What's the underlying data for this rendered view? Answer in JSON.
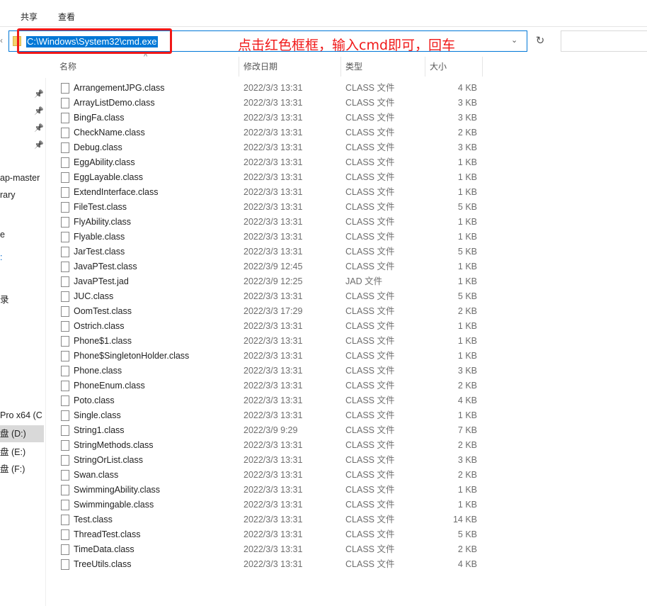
{
  "ribbon": {
    "tabs": [
      "共享",
      "查看"
    ]
  },
  "address": {
    "path": "C:\\Windows\\System32\\cmd.exe"
  },
  "annotation": "点击红色框框，输入cmd即可，回车",
  "columns": {
    "name": "名称",
    "date": "修改日期",
    "type": "类型",
    "size": "大小"
  },
  "sidebar": {
    "items": [
      "ap-master",
      "rary",
      "e",
      ":",
      "录",
      "Pro x64 (C",
      "盘 (D:)",
      "盘 (E:)",
      "盘 (F:)"
    ],
    "selected": "盘 (D:)"
  },
  "files": [
    [
      "ArrangementJPG.class",
      "2022/3/3 13:31",
      "CLASS 文件",
      "4 KB"
    ],
    [
      "ArrayListDemo.class",
      "2022/3/3 13:31",
      "CLASS 文件",
      "3 KB"
    ],
    [
      "BingFa.class",
      "2022/3/3 13:31",
      "CLASS 文件",
      "3 KB"
    ],
    [
      "CheckName.class",
      "2022/3/3 13:31",
      "CLASS 文件",
      "2 KB"
    ],
    [
      "Debug.class",
      "2022/3/3 13:31",
      "CLASS 文件",
      "3 KB"
    ],
    [
      "EggAbility.class",
      "2022/3/3 13:31",
      "CLASS 文件",
      "1 KB"
    ],
    [
      "EggLayable.class",
      "2022/3/3 13:31",
      "CLASS 文件",
      "1 KB"
    ],
    [
      "ExtendInterface.class",
      "2022/3/3 13:31",
      "CLASS 文件",
      "1 KB"
    ],
    [
      "FileTest.class",
      "2022/3/3 13:31",
      "CLASS 文件",
      "5 KB"
    ],
    [
      "FlyAbility.class",
      "2022/3/3 13:31",
      "CLASS 文件",
      "1 KB"
    ],
    [
      "Flyable.class",
      "2022/3/3 13:31",
      "CLASS 文件",
      "1 KB"
    ],
    [
      "JarTest.class",
      "2022/3/3 13:31",
      "CLASS 文件",
      "5 KB"
    ],
    [
      "JavaPTest.class",
      "2022/3/9 12:45",
      "CLASS 文件",
      "1 KB"
    ],
    [
      "JavaPTest.jad",
      "2022/3/9 12:25",
      "JAD 文件",
      "1 KB"
    ],
    [
      "JUC.class",
      "2022/3/3 13:31",
      "CLASS 文件",
      "5 KB"
    ],
    [
      "OomTest.class",
      "2022/3/3 17:29",
      "CLASS 文件",
      "2 KB"
    ],
    [
      "Ostrich.class",
      "2022/3/3 13:31",
      "CLASS 文件",
      "1 KB"
    ],
    [
      "Phone$1.class",
      "2022/3/3 13:31",
      "CLASS 文件",
      "1 KB"
    ],
    [
      "Phone$SingletonHolder.class",
      "2022/3/3 13:31",
      "CLASS 文件",
      "1 KB"
    ],
    [
      "Phone.class",
      "2022/3/3 13:31",
      "CLASS 文件",
      "3 KB"
    ],
    [
      "PhoneEnum.class",
      "2022/3/3 13:31",
      "CLASS 文件",
      "2 KB"
    ],
    [
      "Poto.class",
      "2022/3/3 13:31",
      "CLASS 文件",
      "4 KB"
    ],
    [
      "Single.class",
      "2022/3/3 13:31",
      "CLASS 文件",
      "1 KB"
    ],
    [
      "String1.class",
      "2022/3/9 9:29",
      "CLASS 文件",
      "7 KB"
    ],
    [
      "StringMethods.class",
      "2022/3/3 13:31",
      "CLASS 文件",
      "2 KB"
    ],
    [
      "StringOrList.class",
      "2022/3/3 13:31",
      "CLASS 文件",
      "3 KB"
    ],
    [
      "Swan.class",
      "2022/3/3 13:31",
      "CLASS 文件",
      "2 KB"
    ],
    [
      "SwimmingAbility.class",
      "2022/3/3 13:31",
      "CLASS 文件",
      "1 KB"
    ],
    [
      "Swimmingable.class",
      "2022/3/3 13:31",
      "CLASS 文件",
      "1 KB"
    ],
    [
      "Test.class",
      "2022/3/3 13:31",
      "CLASS 文件",
      "14 KB"
    ],
    [
      "ThreadTest.class",
      "2022/3/3 13:31",
      "CLASS 文件",
      "5 KB"
    ],
    [
      "TimeData.class",
      "2022/3/3 13:31",
      "CLASS 文件",
      "2 KB"
    ],
    [
      "TreeUtils.class",
      "2022/3/3 13:31",
      "CLASS 文件",
      "4 KB"
    ]
  ]
}
